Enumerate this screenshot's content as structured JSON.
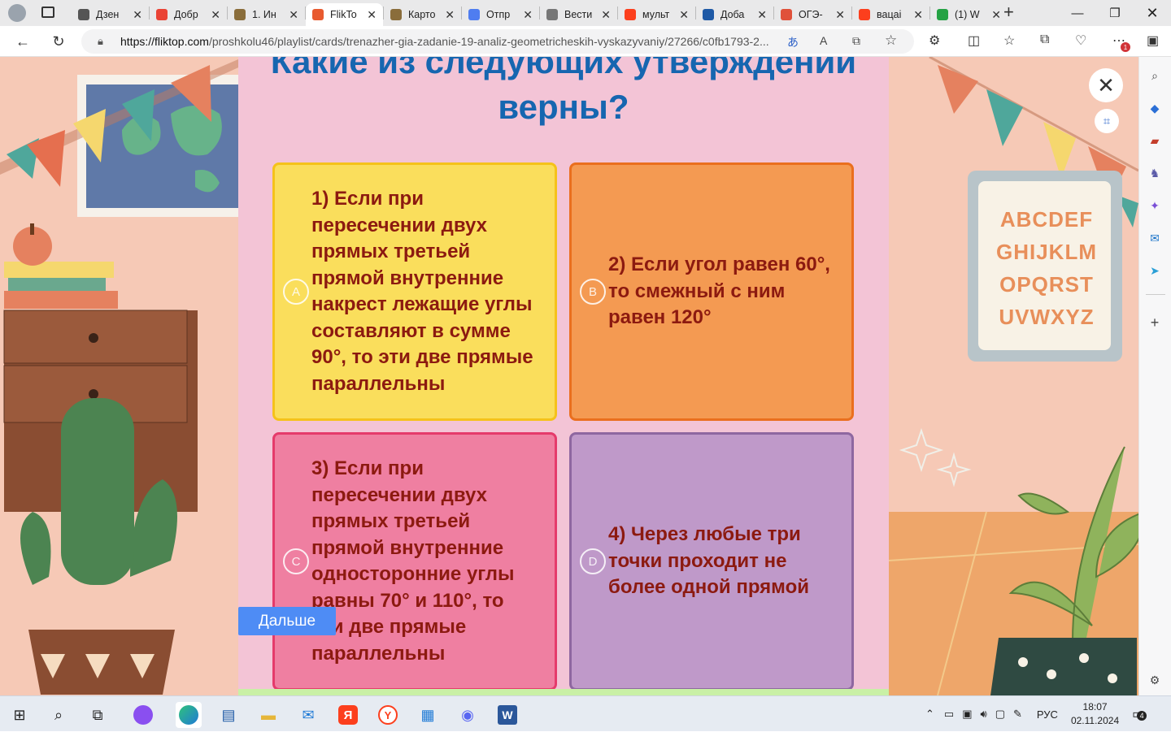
{
  "browser": {
    "tabs": [
      {
        "label": "Дзен",
        "icon": "plus-icon",
        "color": "#555555"
      },
      {
        "label": "Добр",
        "icon": "gmail-icon",
        "color": "#ea4335"
      },
      {
        "label": "1. Ин",
        "icon": "document-icon",
        "color": "#8a6d3b"
      },
      {
        "label": "FlikTo",
        "icon": "fliktop-icon",
        "color": "#e85a2f",
        "active": true
      },
      {
        "label": "Карто",
        "icon": "document-icon",
        "color": "#8a6d3b"
      },
      {
        "label": "Отпр",
        "icon": "mail-icon",
        "color": "#4f7df0"
      },
      {
        "label": "Вести",
        "icon": "page-icon",
        "color": "#777777"
      },
      {
        "label": "мульт",
        "icon": "yandex-icon",
        "color": "#fc3f1d"
      },
      {
        "label": "Доба",
        "icon": "book-icon",
        "color": "#1f5aa6"
      },
      {
        "label": "ОГЭ-",
        "icon": "target-icon",
        "color": "#e0513a"
      },
      {
        "label": "вацаі",
        "icon": "yandex-icon",
        "color": "#fc3f1d"
      },
      {
        "label": "(1) W",
        "icon": "whatsapp-icon",
        "color": "#25a244"
      }
    ],
    "url_host": "https://fliktop.com",
    "url_path": "/proshkolu46/playlist/cards/trenazher-gia-zadanie-19-analiz-geometricheskih-vyskazyvaniy/27266/c0fb1793-2...",
    "notification_count": "1"
  },
  "quiz": {
    "question": "Какие из следующих утверждений верны?",
    "options": [
      {
        "letter": "A",
        "text": "1) Если при пересечении двух прямых третьей прямой внутренние накрест лежащие углы составляют в сумме 90°, то эти две прямые параллельны",
        "bg": "#fade5c",
        "border": "#f5c21a"
      },
      {
        "letter": "B",
        "text": "2) Если угол равен 60°, то смежный с ним равен 120°",
        "bg": "#f49a52",
        "border": "#ea6f1e"
      },
      {
        "letter": "C",
        "text": "3) Если при пересечении двух прямых третьей прямой внутренние односторонние углы равны 70° и 110°, то эти две прямые параллельны",
        "bg": "#ef7fa1",
        "border": "#e53a6b"
      },
      {
        "letter": "D",
        "text": "4) Через любые три точки проходит не более одной прямой",
        "bg": "#bf99c9",
        "border": "#8e67a0"
      }
    ],
    "next_label": "Дальше"
  },
  "alphabet": [
    "ABCDEF",
    "GHIJKLM",
    "OPQRST",
    "UVWXYZ"
  ],
  "taskbar": {
    "lang": "РУС",
    "time": "18:07",
    "date": "02.11.2024",
    "notifications": "4"
  }
}
